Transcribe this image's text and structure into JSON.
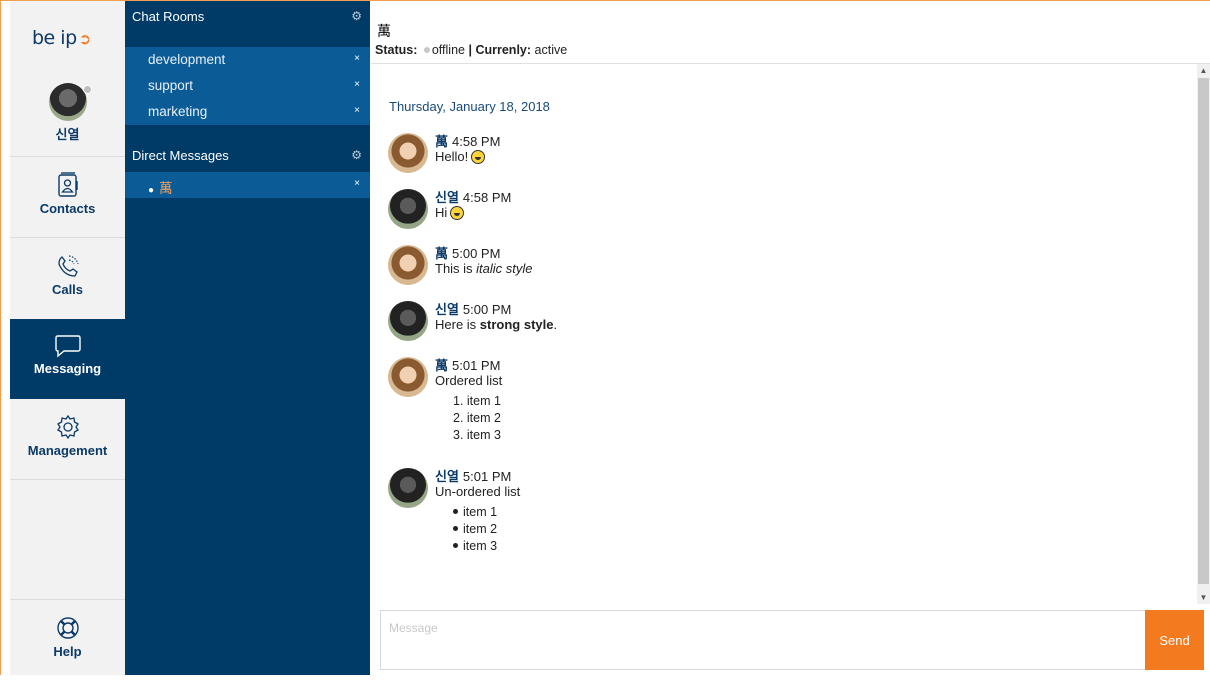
{
  "brand": {
    "logo_text": "be ip",
    "accent": "#f47a20",
    "navy": "#003a66"
  },
  "user": {
    "name": "신열",
    "presence": "offline"
  },
  "nav": {
    "contacts": {
      "label": "Contacts",
      "icon": "contacts-icon"
    },
    "calls": {
      "label": "Calls",
      "icon": "phone-icon"
    },
    "messaging": {
      "label": "Messaging",
      "icon": "chat-bubble-icon",
      "active": true
    },
    "management": {
      "label": "Management",
      "icon": "gear-icon"
    },
    "help": {
      "label": "Help",
      "icon": "lifebuoy-icon"
    }
  },
  "channels": {
    "chat_rooms_title": "Chat Rooms",
    "rooms": [
      {
        "label": "development"
      },
      {
        "label": "support"
      },
      {
        "label": "marketing"
      }
    ],
    "direct_messages_title": "Direct Messages",
    "direct": [
      {
        "label": "萬",
        "dot": "●"
      }
    ],
    "close_glyph": "×"
  },
  "conversation": {
    "title": "萬",
    "status_label": "Status:",
    "status_value": "offline",
    "currently_label": "Currenly:",
    "currently_value": "active",
    "date": "Thursday, January 18, 2018",
    "messages": [
      {
        "author": "萬",
        "time": "4:58 PM",
        "text": "Hello!"
      },
      {
        "author": "신열",
        "time": "4:58 PM",
        "text": "Hi"
      },
      {
        "author": "萬",
        "time": "5:00 PM",
        "prefix": "This is ",
        "em": "italic style"
      },
      {
        "author": "신열",
        "time": "5:00 PM",
        "prefix": "Here is ",
        "strong": "strong style",
        "suffix": "."
      },
      {
        "author": "萬",
        "time": "5:01 PM",
        "text": "Ordered list",
        "items": [
          "1. item 1",
          "2. item 2",
          "3. item 3"
        ]
      },
      {
        "author": "신열",
        "time": "5:01 PM",
        "text": "Un-ordered list",
        "items": [
          "item 1",
          "item 2",
          "item 3"
        ]
      }
    ]
  },
  "composer": {
    "placeholder": "Message",
    "send_label": "Send"
  }
}
